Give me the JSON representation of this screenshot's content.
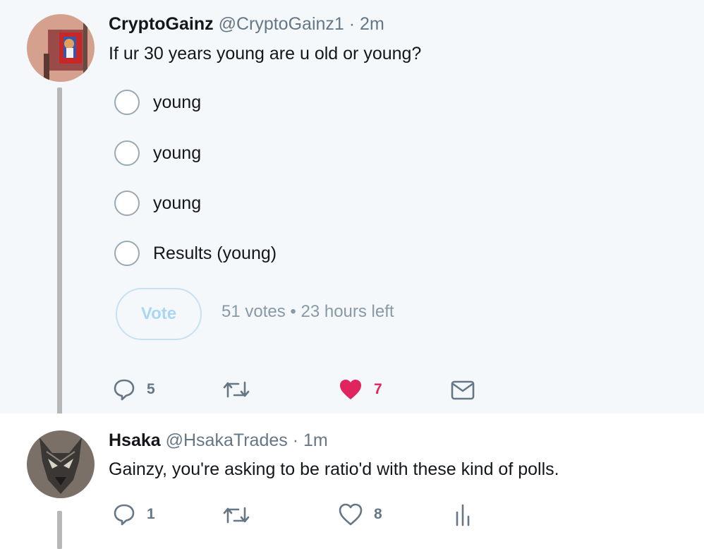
{
  "tweets": [
    {
      "author": {
        "name": "CryptoGainz",
        "handle": "@CryptoGainz1",
        "separator": "·",
        "time": "2m",
        "avatar_icon": "avatar-crypto-gainz"
      },
      "text": "If ur 30 years young are u old or young?",
      "poll": {
        "options": [
          "young",
          "young",
          "young",
          "Results (young)"
        ],
        "vote_label": "Vote",
        "votes": "51 votes",
        "meta_sep": "•",
        "time_left": "23 hours left"
      },
      "actions": {
        "reply_count": "5",
        "retweet_count": "",
        "like_count": "7",
        "liked": true
      }
    },
    {
      "author": {
        "name": "Hsaka",
        "handle": "@HsakaTrades",
        "separator": "·",
        "time": "1m",
        "avatar_icon": "avatar-wolf"
      },
      "text": "Gainzy, you're asking to be ratio'd with these kind of polls.",
      "actions": {
        "reply_count": "1",
        "retweet_count": "",
        "like_count": "8",
        "liked": false
      }
    }
  ],
  "colors": {
    "highlight_bg": "#f5f8fa",
    "text_primary": "#14171a",
    "text_secondary": "#657786",
    "like_red": "#e0245e",
    "vote_border": "#c4e2f4",
    "thread_line": "#b7b7b7"
  },
  "icons": [
    "reply-icon",
    "retweet-icon",
    "like-icon",
    "direct-message-icon",
    "analytics-icon"
  ]
}
